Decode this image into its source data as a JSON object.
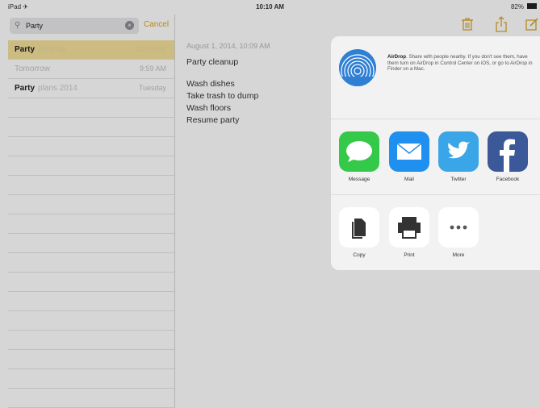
{
  "status_bar": {
    "carrier": "iPad ✈︎",
    "time": "10:10 AM",
    "battery": "82%"
  },
  "search": {
    "value": "Party",
    "cancel_label": "Cancel"
  },
  "notes_list": [
    {
      "title": "Party",
      "title_rest": "cleanup",
      "time": "10:09 AM",
      "selected": true
    },
    {
      "title": "Tomorrow",
      "title_rest": "",
      "time": "9:59 AM",
      "selected": false
    },
    {
      "title": "Party",
      "title_rest": "plans 2014",
      "time": "Tuesday",
      "selected": false
    }
  ],
  "note": {
    "date": "August 1, 2014, 10:09 AM",
    "heading": "Party cleanup",
    "lines": [
      "Wash dishes",
      "Take trash to dump",
      "Wash floors",
      "Resume party"
    ]
  },
  "share_sheet": {
    "airdrop_title": "AirDrop",
    "airdrop_text": ". Share with people nearby. If you don't see them, have them turn on AirDrop in Control Center on iOS, or go to AirDrop in Finder on a Mac.",
    "apps": [
      {
        "label": "Message",
        "icon": "message-icon",
        "color": "#35c94a"
      },
      {
        "label": "Mail",
        "icon": "mail-icon",
        "color": "#1f8ff0"
      },
      {
        "label": "Twitter",
        "icon": "twitter-icon",
        "color": "#3aa6e8"
      },
      {
        "label": "Facebook",
        "icon": "facebook-icon",
        "color": "#3b5998"
      }
    ],
    "actions": [
      {
        "label": "Copy",
        "icon": "copy-icon"
      },
      {
        "label": "Print",
        "icon": "print-icon"
      },
      {
        "label": "More",
        "icon": "more-icon"
      }
    ]
  },
  "colors": {
    "accent": "#d4a62a",
    "selected_row": "#f3e19a"
  }
}
